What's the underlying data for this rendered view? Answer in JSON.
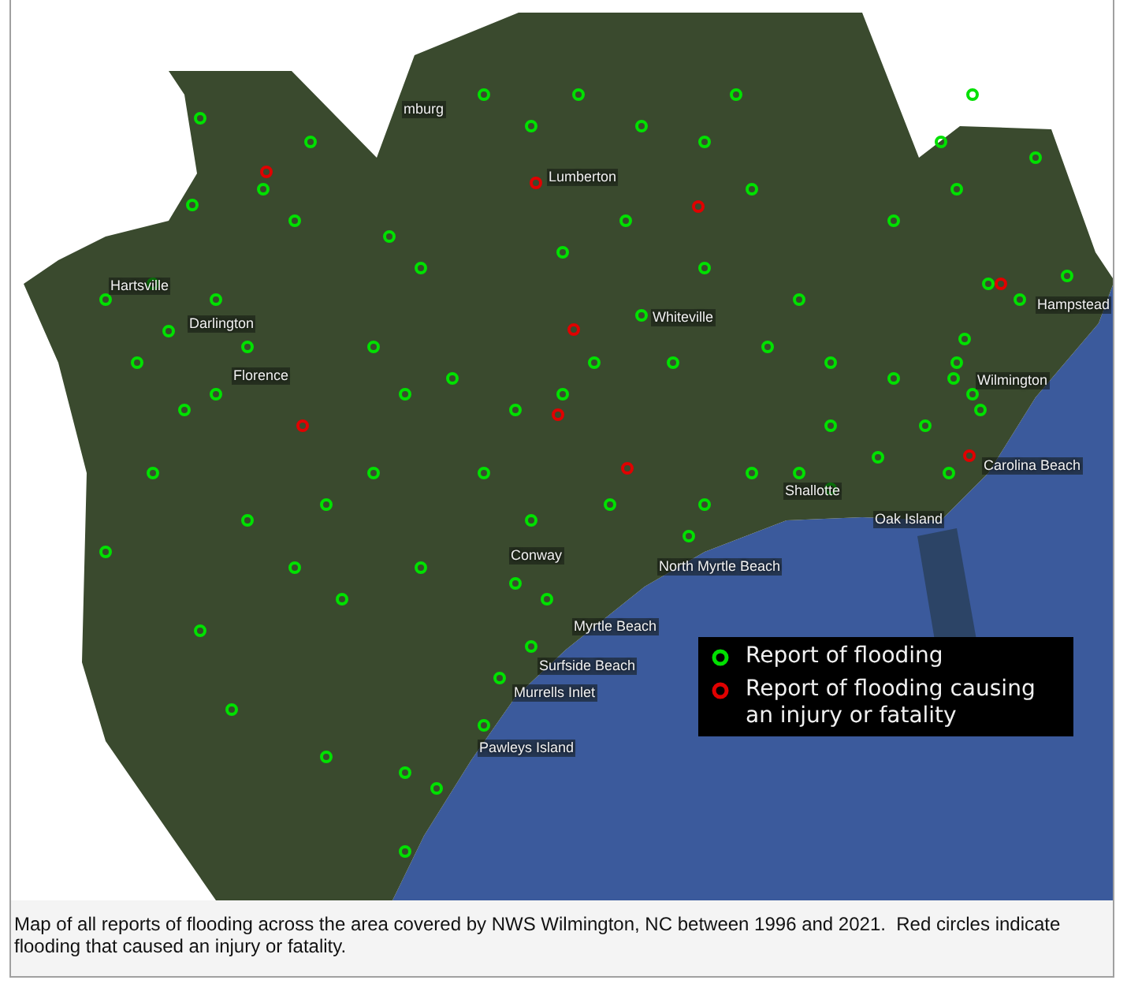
{
  "map": {
    "places": [
      {
        "name": "mburg"
      },
      {
        "name": "Lumberton"
      },
      {
        "name": "Hartsville"
      },
      {
        "name": "Darlington"
      },
      {
        "name": "Florence"
      },
      {
        "name": "Whiteville"
      },
      {
        "name": "Hampstead"
      },
      {
        "name": "Wilmington"
      },
      {
        "name": "Carolina Beach"
      },
      {
        "name": "Shallotte"
      },
      {
        "name": "Oak Island"
      },
      {
        "name": "Conway"
      },
      {
        "name": "North Myrtle Beach"
      },
      {
        "name": "Myrtle Beach"
      },
      {
        "name": "Surfside Beach"
      },
      {
        "name": "Murrells Inlet"
      },
      {
        "name": "Pawleys Island"
      }
    ],
    "legend": [
      {
        "label": "Report of flooding",
        "color": "#00e000"
      },
      {
        "label": "Report of flooding causing an injury or fatality",
        "color": "#e00000"
      }
    ]
  },
  "caption": "Map of all reports of flooding across the area covered by NWS Wilmington, NC between 1996 and 2021.  Red circles indicate flooding that caused an injury or fatality."
}
